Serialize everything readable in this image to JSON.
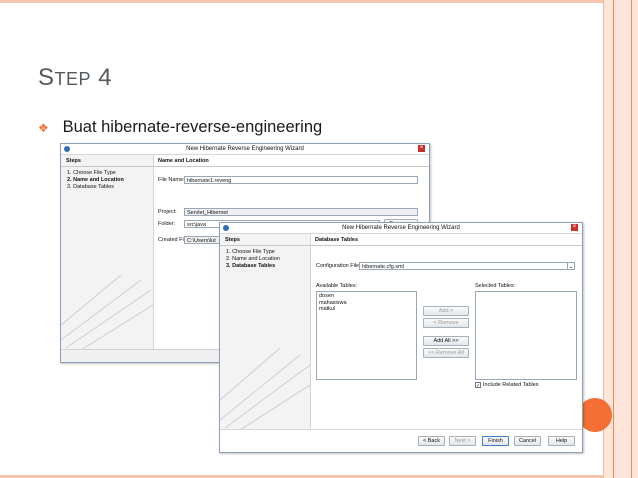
{
  "slide": {
    "title_first": "S",
    "title_rest": "TEP",
    "title_num": "4",
    "bullet_text": "Buat hibernate-reverse-engineering"
  },
  "wizard_back": {
    "title": "New Hibernate Reverse Engineering Wizard",
    "steps_header": "Steps",
    "steps": [
      {
        "num": "1.",
        "label": "Choose File Type"
      },
      {
        "num": "2.",
        "label": "Name and Location"
      },
      {
        "num": "3.",
        "label": "Database Tables"
      }
    ],
    "panel_header": "Name and Location",
    "file_name_label": "File Name:",
    "file_name_value": "hibernate1.reveng",
    "project_label": "Project:",
    "project_value": "Servlet_Hibernet",
    "folder_label": "Folder:",
    "folder_value": "src\\java",
    "browse_label": "Browse...",
    "created_file_label": "Created File:",
    "created_file_value": "C:\\Users\\lut"
  },
  "wizard_front": {
    "title": "New Hibernate Reverse Engineering Wizard",
    "steps_header": "Steps",
    "steps": [
      {
        "num": "1.",
        "label": "Choose File Type"
      },
      {
        "num": "2.",
        "label": "Name and Location"
      },
      {
        "num": "3.",
        "label": "Database Tables"
      }
    ],
    "panel_header": "Database Tables",
    "config_label": "Configuration File:",
    "config_value": "hibernate.cfg.xml",
    "available_label": "Available Tables:",
    "available_tables": [
      "dosen",
      "mahasiswa",
      "matkul"
    ],
    "selected_label": "Selected Tables:",
    "add_label": "Add >",
    "remove_label": "< Remove",
    "add_all_label": "Add All >>",
    "remove_all_label": "<< Remove All",
    "include_related_label": "Include Related Tables",
    "include_related_checked": true,
    "buttons": {
      "back": "< Back",
      "next": "Next >",
      "finish": "Finish",
      "cancel": "Cancel",
      "help": "Help"
    }
  },
  "colors": {
    "accent": "#f36f34",
    "frame": "#f4c6ad",
    "title_text": "#555a5f"
  }
}
